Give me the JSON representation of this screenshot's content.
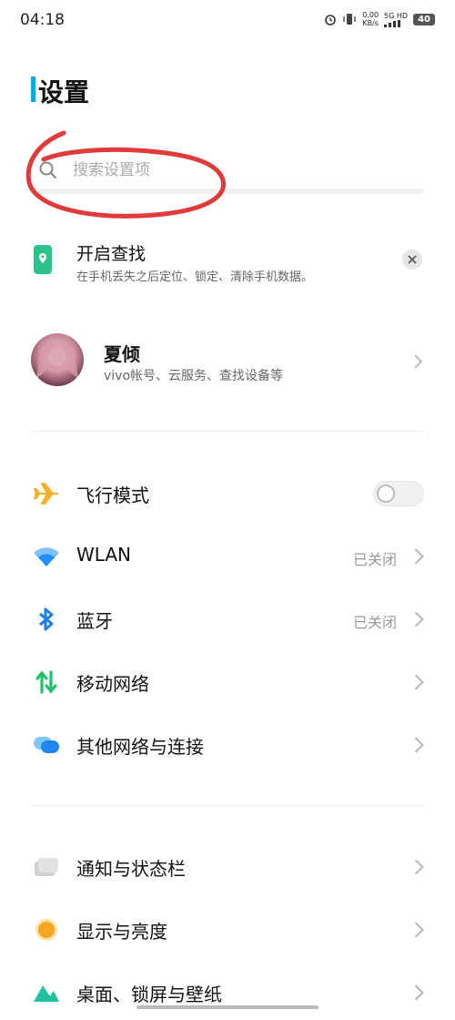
{
  "status_bar": {
    "time": "04:18",
    "speed_value": "0.00",
    "speed_unit": "KB/s",
    "network_5g": "5G",
    "network_hd": "HD",
    "battery": "40"
  },
  "page_title": "设置",
  "search": {
    "placeholder": "搜索设置项"
  },
  "find_card": {
    "title": "开启查找",
    "description": "在手机丢失之后定位、锁定、清除手机数据。"
  },
  "account": {
    "name": "夏倾",
    "subtitle": "vivo帐号、云服务、查找设备等"
  },
  "section1": [
    {
      "label": "飞行模式",
      "icon": "airplane-icon",
      "value": "",
      "toggle": true,
      "toggle_on": false
    },
    {
      "label": "WLAN",
      "icon": "wifi-icon",
      "value": "已关闭"
    },
    {
      "label": "蓝牙",
      "icon": "bluetooth-icon",
      "value": "已关闭"
    },
    {
      "label": "移动网络",
      "icon": "mobile-network-icon",
      "value": ""
    },
    {
      "label": "其他网络与连接",
      "icon": "other-network-icon",
      "value": ""
    }
  ],
  "section2": [
    {
      "label": "通知与状态栏",
      "icon": "notification-icon"
    },
    {
      "label": "显示与亮度",
      "icon": "display-icon"
    },
    {
      "label": "桌面、锁屏与壁纸",
      "icon": "wallpaper-icon"
    }
  ],
  "colors": {
    "accent": "#1aa0f0",
    "airplane": "#f6b024",
    "wifi": "#1e90ff",
    "bluetooth": "#1a7fe0",
    "mobile": "#22c06a",
    "annotation": "#e03a3a"
  }
}
